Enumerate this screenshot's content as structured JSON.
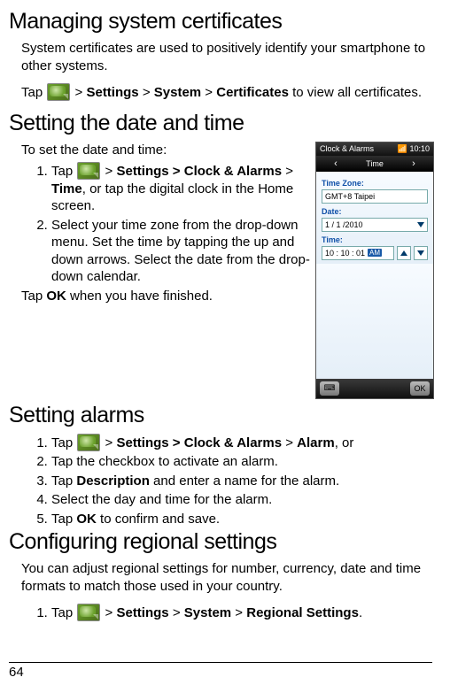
{
  "page_number": "64",
  "sections": {
    "certs": {
      "heading": "Managing system certificates",
      "intro": "System certificates are used to positively identify your smartphone to other systems.",
      "tap_prefix": "Tap ",
      "path_settings": "Settings",
      "path_system": "System",
      "path_certificates": "Certificates",
      "tap_suffix": " to view all certificates.",
      "sep": " > "
    },
    "datetime": {
      "heading": "Setting the date and time",
      "intro": "To set the date and time:",
      "step1_pre": "Tap ",
      "step1_path": "Settings > Clock & Alarms",
      "step1_path2_sep": " > ",
      "step1_path2": "Time",
      "step1_post": ", or tap the digital clock in the Home screen.",
      "step2": "Select your time zone from the drop-down menu. Set the time by tapping the up and down arrows. Select the date from the drop-down calendar.",
      "outro_pre": "Tap ",
      "outro_bold": "OK",
      "outro_post": " when you have finished."
    },
    "alarms": {
      "heading": "Setting alarms",
      "step1_pre": "Tap ",
      "step1_path": "Settings > Clock & Alarms",
      "step1_sep": " > ",
      "step1_alarm": "Alarm",
      "step1_post": ", or",
      "step2": "Tap the checkbox to activate an alarm.",
      "step3_pre": "Tap ",
      "step3_bold": "Description",
      "step3_post": " and enter a name for the alarm.",
      "step4": "Select the day and time for the alarm.",
      "step5_pre": "Tap ",
      "step5_bold": "OK",
      "step5_post": " to confirm and save."
    },
    "regional": {
      "heading": "Configuring regional settings",
      "intro": "You can adjust regional settings for number, currency, date and time formats to match those used in your country.",
      "step1_pre": "Tap ",
      "path_settings": "Settings",
      "path_system": "System",
      "path_regional": "Regional Settings",
      "sep": " > ",
      "period": "."
    }
  },
  "device": {
    "title": "Clock & Alarms",
    "status_time": "10:10",
    "tab_prev_icon": "‹",
    "tab_label": "Time",
    "tab_next_icon": "›",
    "tz_label": "Time Zone:",
    "tz_value": "GMT+8 Taipei",
    "date_label": "Date:",
    "date_value": "1  /  1  /2010",
    "time_label": "Time:",
    "time_value": "10 : 10 : 01",
    "ampm": "AM",
    "ok_label": "OK",
    "kbd_icon": "⌨"
  }
}
